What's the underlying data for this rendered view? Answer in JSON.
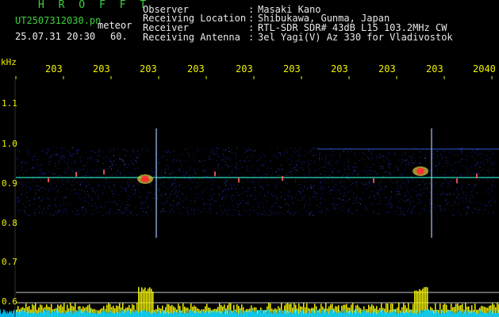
{
  "header": {
    "title": "H R O F F T",
    "filename": "UT2507312030.pn",
    "mode": "meteor",
    "datetime": "25.07.31 20:30",
    "value": "60."
  },
  "info": [
    {
      "label": "Observer",
      "value": "Masaki Kano"
    },
    {
      "label": "Receiving Location",
      "value": "Shibukawa, Gunma, Japan"
    },
    {
      "label": "Receiver",
      "value": "RTL-SDR SDR# 43dB L15 103.2MHz CW"
    },
    {
      "label": "Receiving Antenna",
      "value": "3el Yagi(V) Az 330 for Vladivostok"
    }
  ],
  "separator": ":",
  "axis": {
    "unit": "kHz",
    "y_ticks": [
      "1.1",
      "1.0",
      "0.9",
      "0.8",
      "0.7",
      "0.6"
    ],
    "x_ticks": [
      "203",
      "203",
      "203",
      "203",
      "203",
      "203",
      "203",
      "203",
      "203",
      "2040"
    ]
  },
  "colors": {
    "background": "#000000",
    "title": "#3cd23c",
    "axis_text": "#f0f000",
    "noise": "#1e32c8",
    "signal_bright": "#ff3030",
    "level_trace": "#f0f000",
    "noise_floor": "#00c8ff"
  }
}
